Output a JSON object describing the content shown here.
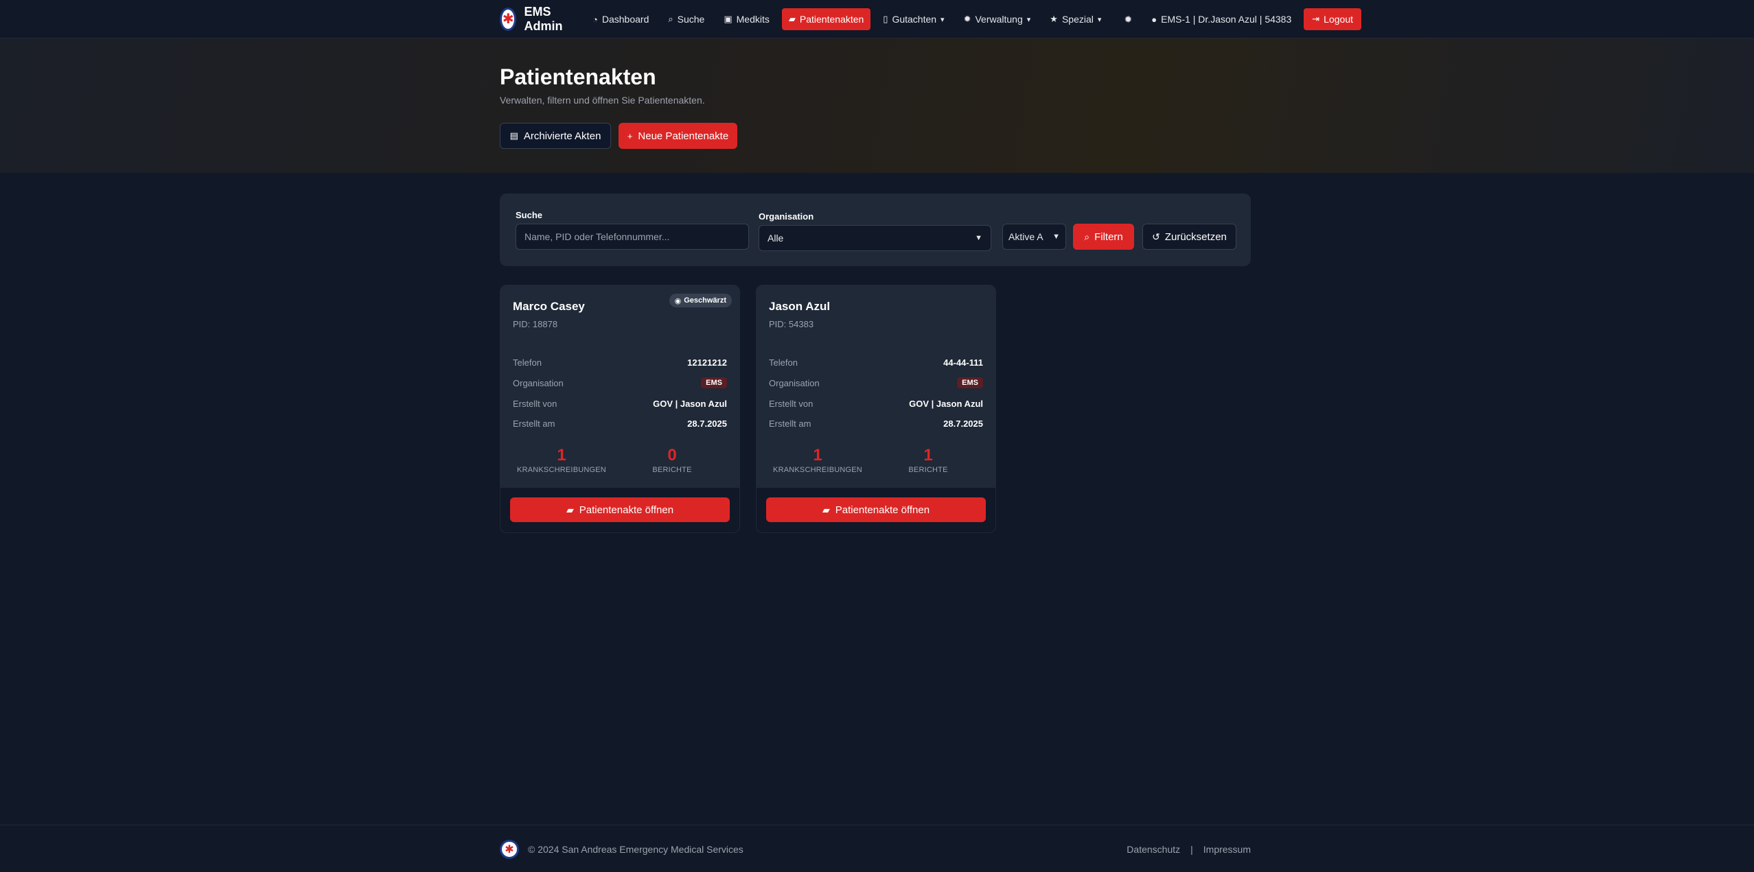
{
  "nav": {
    "brand": "EMS Admin",
    "logo_glyph": "✱",
    "items": [
      {
        "label": "Dashboard",
        "icon": "gauge-icon",
        "glyph": "◔",
        "active": false,
        "dropdown": false
      },
      {
        "label": "Suche",
        "icon": "search-icon",
        "glyph": "⌕",
        "active": false,
        "dropdown": false
      },
      {
        "label": "Medkits",
        "icon": "medkit-icon",
        "glyph": "▣",
        "active": false,
        "dropdown": false
      },
      {
        "label": "Patientenakten",
        "icon": "folder-open-icon",
        "glyph": "▰",
        "active": true,
        "dropdown": false
      },
      {
        "label": "Gutachten",
        "icon": "file-icon",
        "glyph": "▯",
        "active": false,
        "dropdown": true
      },
      {
        "label": "Verwaltung",
        "icon": "gear-icon",
        "glyph": "✹",
        "active": false,
        "dropdown": true
      },
      {
        "label": "Spezial",
        "icon": "star-icon",
        "glyph": "★",
        "active": false,
        "dropdown": true
      }
    ],
    "theme_glyph": "✹",
    "user_label": "EMS-1 | Dr.Jason Azul | 54383",
    "user_glyph": "●",
    "logout_label": "Logout",
    "logout_glyph": "⇥"
  },
  "hero": {
    "title": "Patientenakten",
    "subtitle": "Verwalten, filtern und öffnen Sie Patientenakten.",
    "archive_label": "Archivierte Akten",
    "archive_glyph": "▤",
    "new_label": "Neue Patientenakte",
    "new_glyph": "+"
  },
  "filter": {
    "search_label": "Suche",
    "search_placeholder": "Name, PID oder Telefonnummer...",
    "search_value": "",
    "org_label": "Organisation",
    "org_value": "Alle",
    "status_value": "Aktive A",
    "filter_label": "Filtern",
    "filter_glyph": "⌕",
    "reset_label": "Zurücksetzen",
    "reset_glyph": "↺"
  },
  "cards": [
    {
      "name": "Marco Casey",
      "pid": "PID: 18878",
      "badge": "Geschwärzt",
      "badge_glyph": "◉",
      "phone_key": "Telefon",
      "phone": "12121212",
      "org_key": "Organisation",
      "org": "EMS",
      "creator_key": "Erstellt von",
      "creator": "GOV | Jason Azul",
      "date_key": "Erstellt am",
      "date": "28.7.2025",
      "sick_count": "1",
      "sick_label": "KRANKSCHREIBUNGEN",
      "report_count": "0",
      "report_label": "BERICHTE",
      "open_label": "Patientenakte öffnen",
      "open_glyph": "▰"
    },
    {
      "name": "Jason Azul",
      "pid": "PID: 54383",
      "badge": "",
      "phone_key": "Telefon",
      "phone": "44-44-111",
      "org_key": "Organisation",
      "org": "EMS",
      "creator_key": "Erstellt von",
      "creator": "GOV | Jason Azul",
      "date_key": "Erstellt am",
      "date": "28.7.2025",
      "sick_count": "1",
      "sick_label": "KRANKSCHREIBUNGEN",
      "report_count": "1",
      "report_label": "BERICHTE",
      "open_label": "Patientenakte öffnen",
      "open_glyph": "▰"
    }
  ],
  "footer": {
    "copyright": "© 2024 San Andreas Emergency Medical Services",
    "link_privacy": "Datenschutz",
    "separator": "|",
    "link_imprint": "Impressum"
  },
  "colors": {
    "accent": "#dc2626",
    "background": "#111827",
    "panel": "#1f2937"
  }
}
